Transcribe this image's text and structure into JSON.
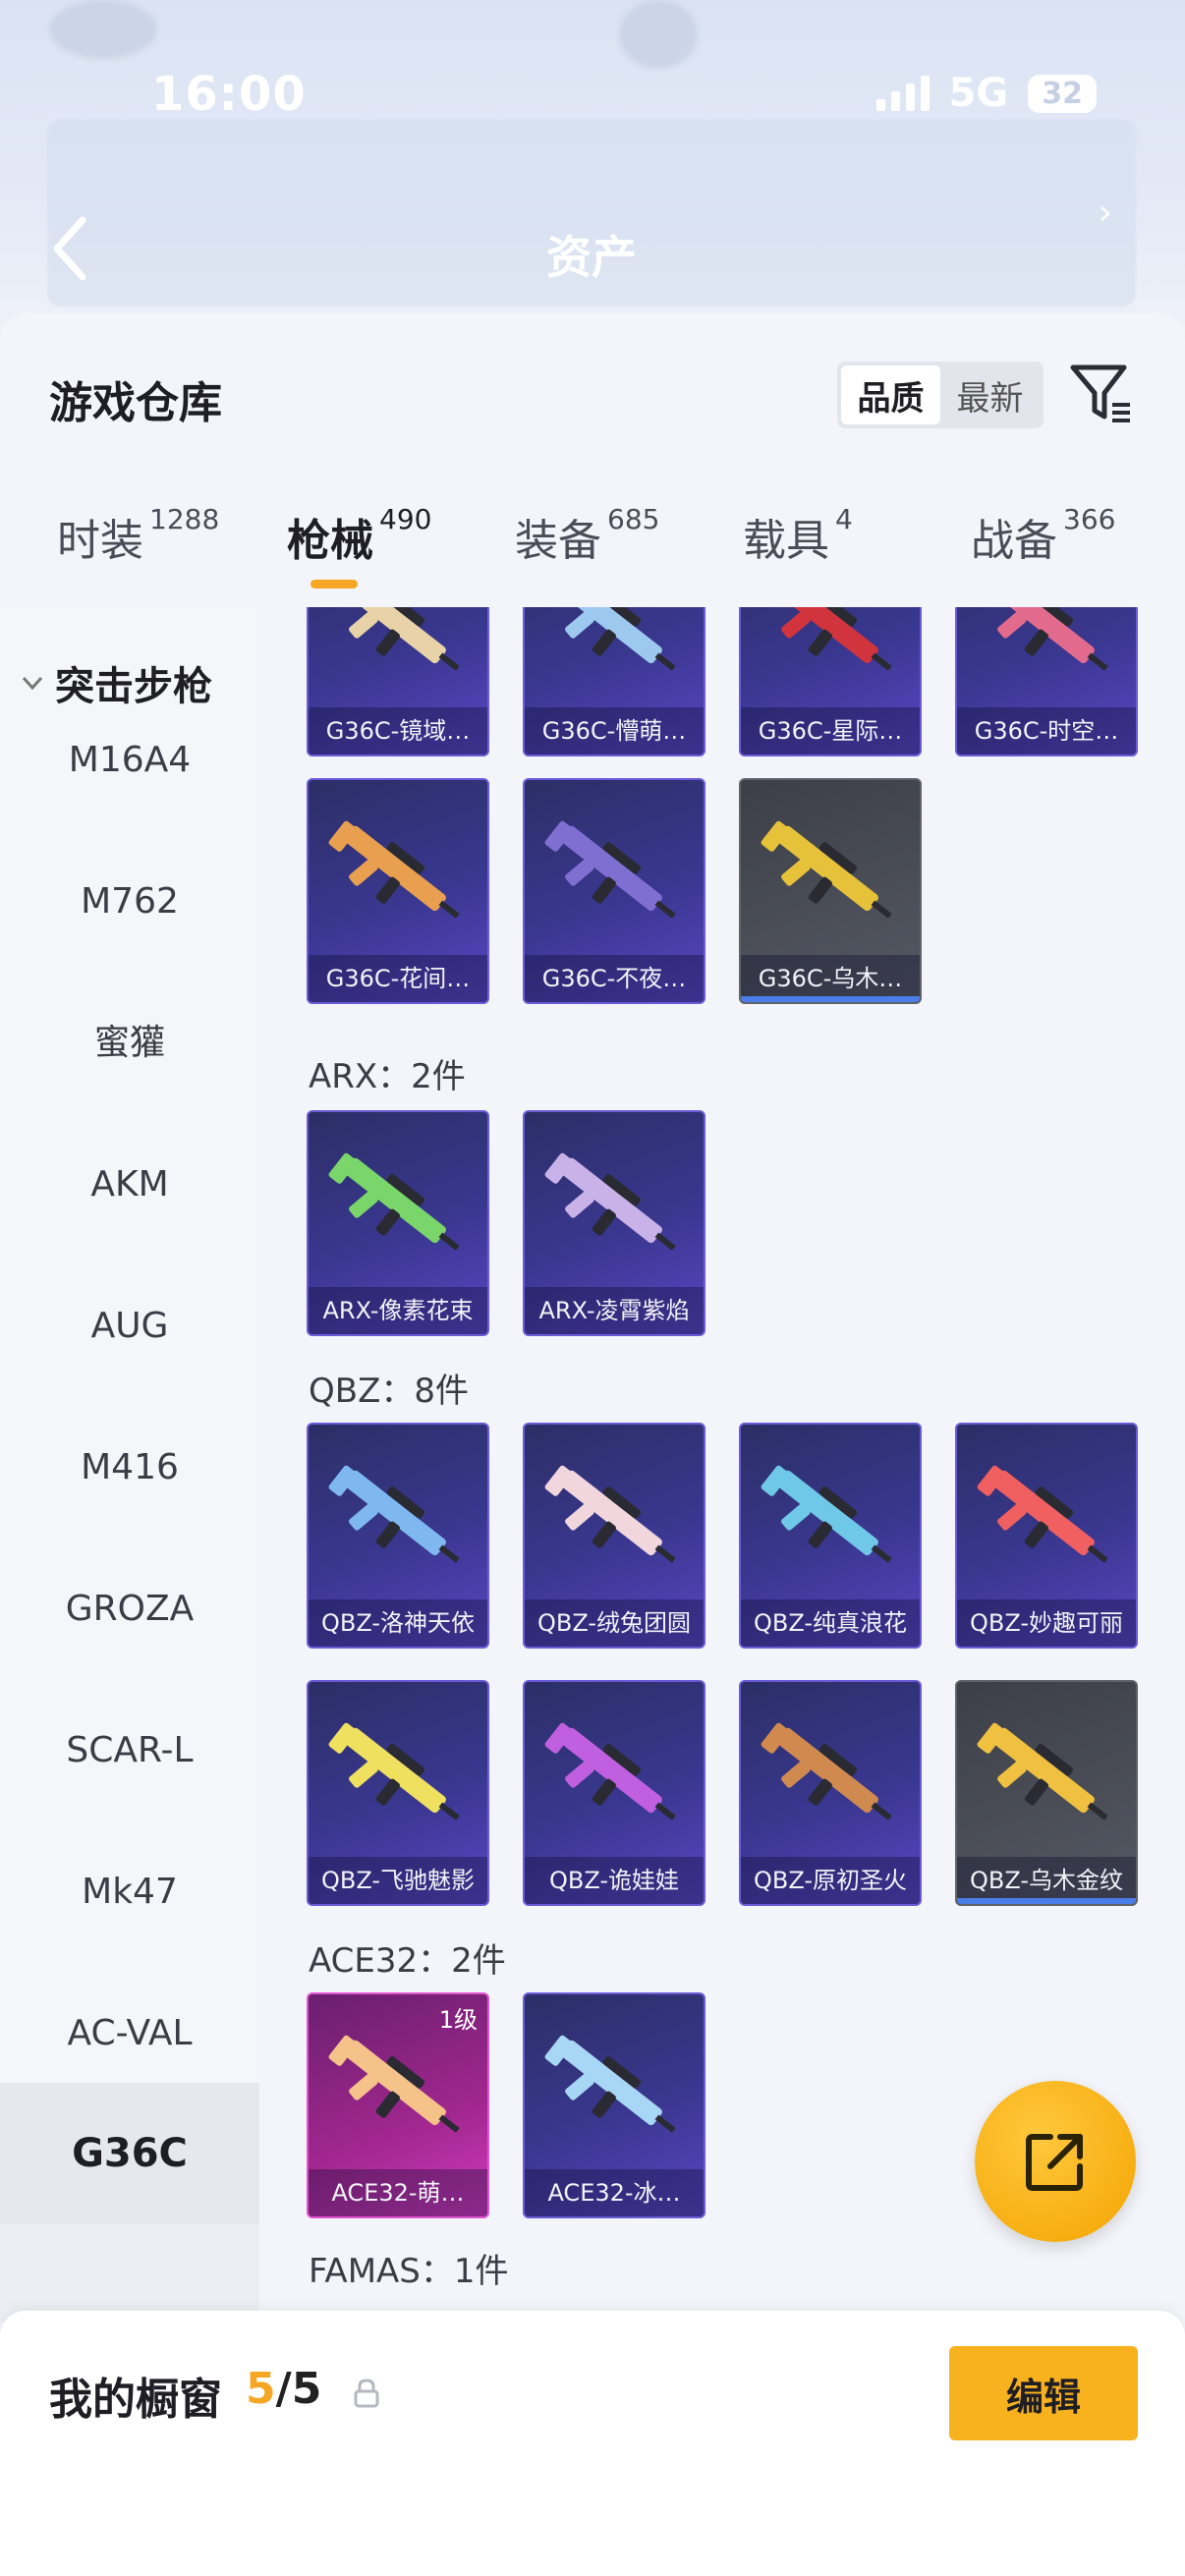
{
  "status_bar": {
    "time": "16:00",
    "network": "5G",
    "battery": "32"
  },
  "header": {
    "title": "资产"
  },
  "sheet": {
    "title": "游戏仓库",
    "sort_options": [
      "品质",
      "最新"
    ],
    "active_sort": "品质"
  },
  "tabs": [
    {
      "label": "时装",
      "count": "1288"
    },
    {
      "label": "枪械",
      "count": "490"
    },
    {
      "label": "装备",
      "count": "685"
    },
    {
      "label": "载具",
      "count": "4"
    },
    {
      "label": "战备",
      "count": "366"
    }
  ],
  "active_tab": "枪械",
  "sidenav": {
    "section": "突击步枪",
    "items": [
      "M16A4",
      "M762",
      "蜜獾",
      "AKM",
      "AUG",
      "M416",
      "GROZA",
      "SCAR-L",
      "Mk47",
      "AC-VAL",
      "G36C"
    ],
    "active": "G36C"
  },
  "groups": {
    "arx": "ARX：2件",
    "qbz": "QBZ：8件",
    "ace32": "ACE32：2件",
    "famas": "FAMAS：1件"
  },
  "cards": {
    "g36_row1": [
      "G36C-镜域…",
      "G36C-懵萌…",
      "G36C-星际…",
      "G36C-时空…"
    ],
    "g36_row2": [
      "G36C-花间…",
      "G36C-不夜…",
      "G36C-乌木…"
    ],
    "arx": [
      "ARX-像素花束",
      "ARX-凌霄紫焰"
    ],
    "qbz_row1": [
      "QBZ-洛神天依",
      "QBZ-绒兔团圆",
      "QBZ-纯真浪花",
      "QBZ-妙趣可丽"
    ],
    "qbz_row2": [
      "QBZ-飞驰魅影",
      "QBZ-诡娃娃",
      "QBZ-原初圣火",
      "QBZ-乌木金纹"
    ],
    "ace32": [
      "ACE32-萌…",
      "ACE32-冰…"
    ],
    "ace32_level": "1级"
  },
  "showcase": {
    "title": "我的橱窗",
    "current": "5",
    "total": "/5",
    "edit_label": "编辑"
  },
  "colors": {
    "accent": "#f5a623",
    "card_purple": "#3a3790",
    "card_grey": "#4a4d55",
    "card_pink": "#a1278f"
  }
}
